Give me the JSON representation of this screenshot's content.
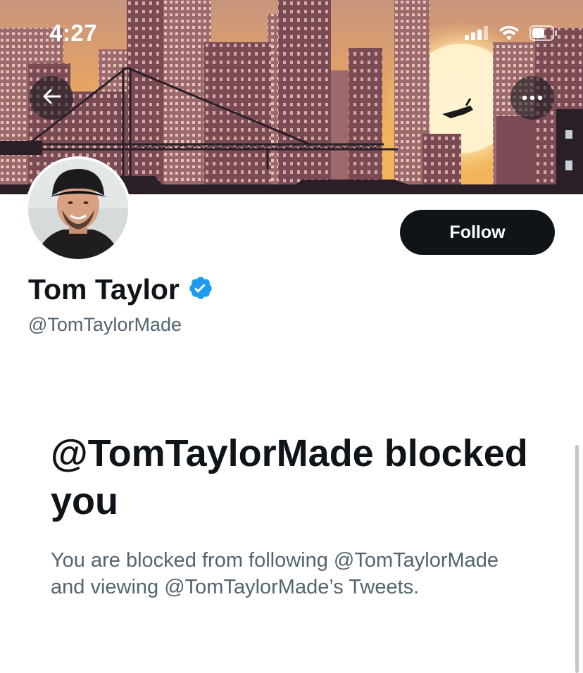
{
  "status_bar": {
    "time": "4:27"
  },
  "header": {
    "back_icon": "arrow-left-icon",
    "more_icon": "more-horizontal-icon"
  },
  "profile": {
    "name": "Tom Taylor",
    "handle": "@TomTaylorMade",
    "verified": true,
    "follow_label": "Follow"
  },
  "blocked": {
    "title": "@TomTaylorMade blocked you",
    "description": "You are blocked from following @TomTaylorMade and viewing @TomTaylorMade’s Tweets."
  },
  "colors": {
    "primary_text": "#0f1419",
    "secondary_text": "#536471",
    "verified_badge": "#1d9bf0",
    "follow_button": "#0f1419"
  }
}
